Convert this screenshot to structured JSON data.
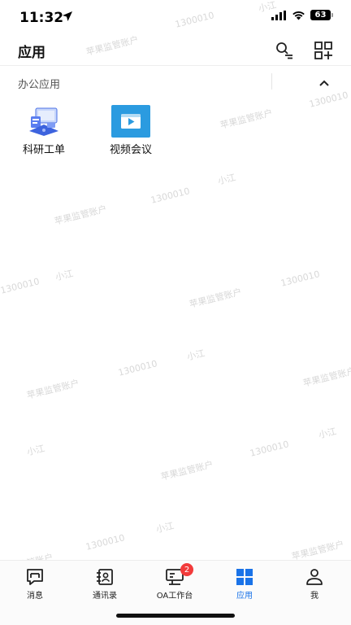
{
  "status_bar": {
    "time": "11:32",
    "battery": "63"
  },
  "header": {
    "title": "应用",
    "icons": [
      "search-list-icon",
      "app-scan-icon"
    ]
  },
  "section": {
    "title": "办公应用",
    "collapse_icon": "chevron-up-icon",
    "apps": [
      {
        "label": "科研工单",
        "icon": "research-ticket-icon"
      },
      {
        "label": "视频会议",
        "icon": "video-meeting-icon"
      }
    ]
  },
  "watermark": {
    "company": "苹果监管账户",
    "number": "1300010",
    "name": "小江"
  },
  "bottom_nav": {
    "items": [
      {
        "label": "消息",
        "icon": "message-icon"
      },
      {
        "label": "通讯录",
        "icon": "contacts-icon"
      },
      {
        "label": "OA工作台",
        "icon": "workbench-icon",
        "badge": "2"
      },
      {
        "label": "应用",
        "icon": "apps-grid-icon",
        "active": true
      },
      {
        "label": "我",
        "icon": "profile-icon"
      }
    ]
  },
  "colors": {
    "accent": "#1a73e8",
    "badge": "#f23b3b",
    "video_tile": "#2b9be0",
    "watermark": "#d8d8d8"
  }
}
